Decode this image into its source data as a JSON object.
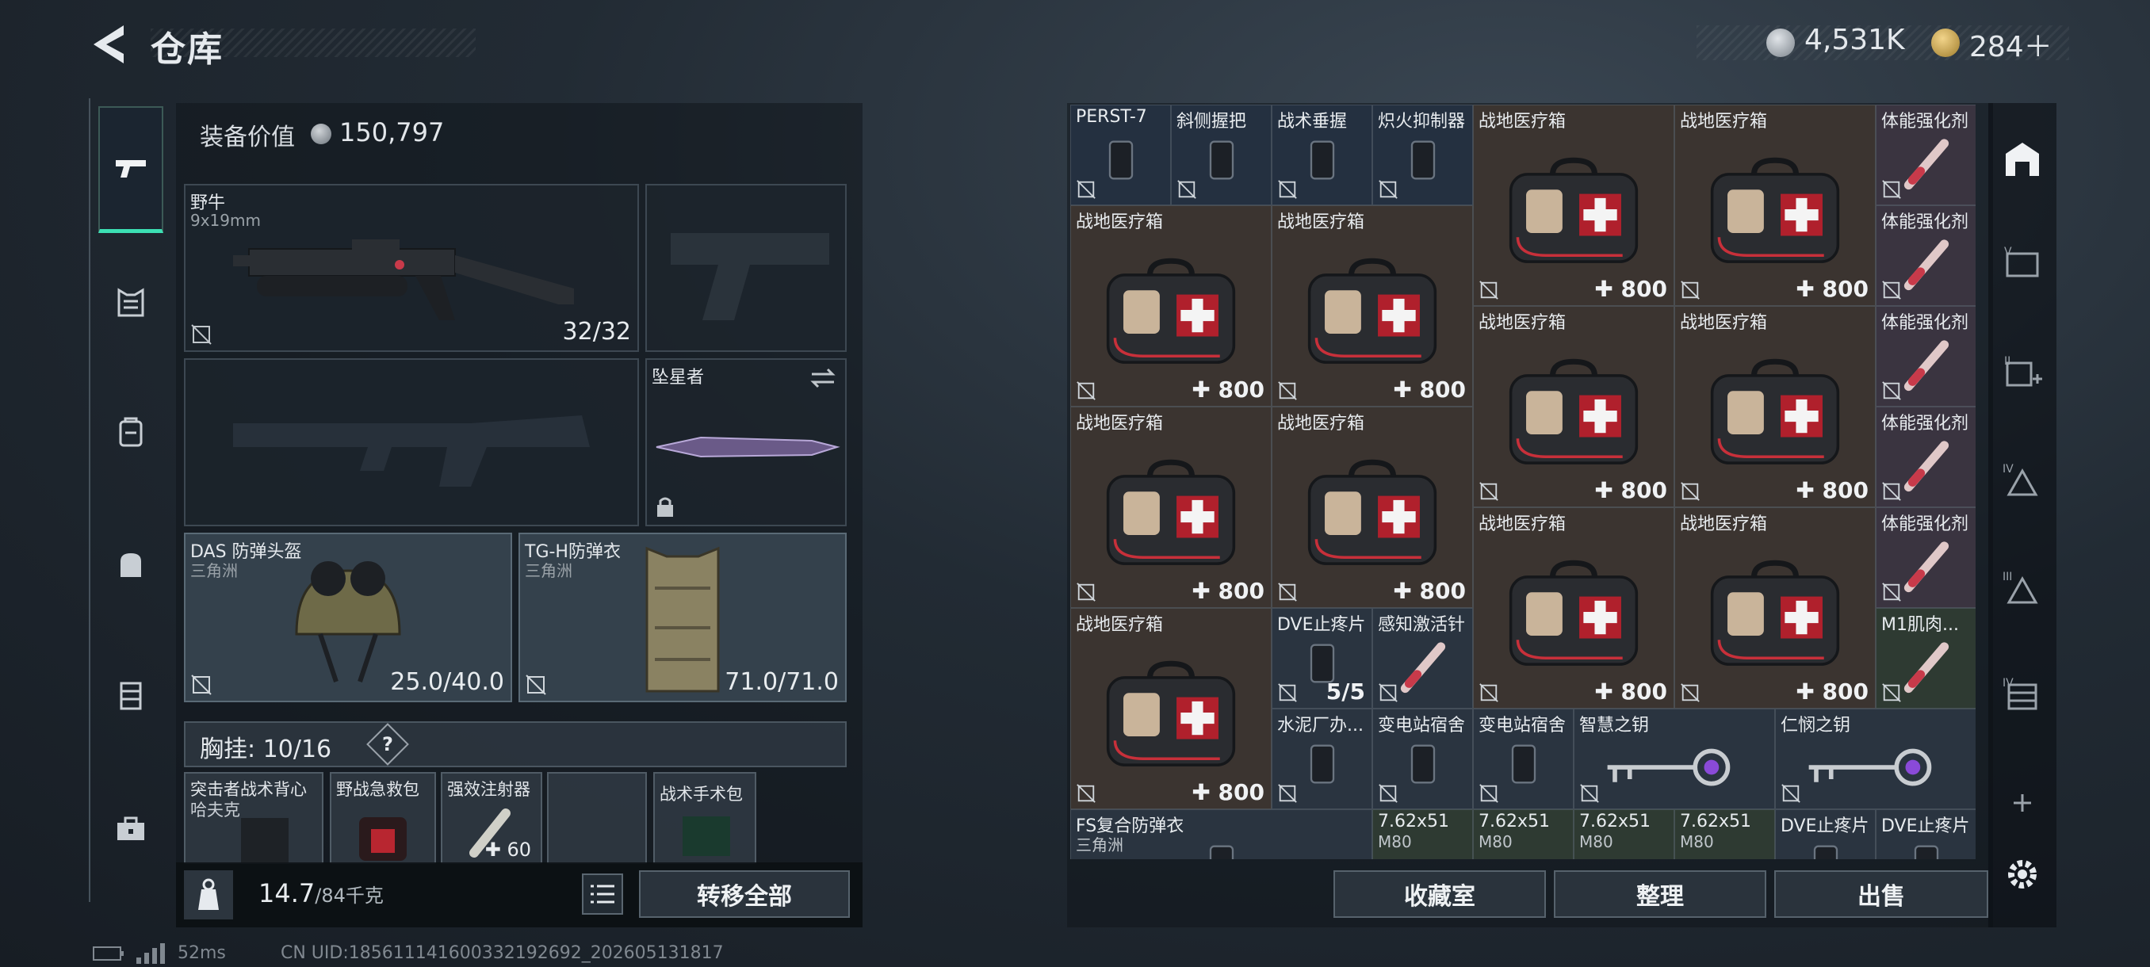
{
  "header": {
    "title": "仓库",
    "silver_amount": "4,531K",
    "gold_amount": "284＋"
  },
  "nav": {
    "items": [
      "weapons",
      "armor",
      "backpack-alt",
      "backpack",
      "chest-rig",
      "toolbox"
    ],
    "active": "weapons"
  },
  "equipment": {
    "value_label": "装备价值",
    "value": "150,797",
    "primary_weapon": {
      "name": "野牛",
      "ammo_type": "9x19mm",
      "ammo": "32/32"
    },
    "melee": {
      "name": "坠星者"
    },
    "helmet": {
      "name": "DAS 防弹头盔",
      "origin": "三角洲",
      "durability": "25.0/40.0"
    },
    "body_armor": {
      "name": "TG-H防弹衣",
      "origin": "三角洲",
      "durability": "71.0/71.0"
    },
    "chest_rig_label": "胸挂:",
    "chest_rig_capacity": "10/16",
    "help": "?",
    "rig_items": [
      {
        "name": "突击者战术背心",
        "sub": "哈夫克"
      },
      {
        "name": "野战急救包"
      },
      {
        "name": "强效注射器",
        "value": "60"
      },
      {
        "name": ""
      },
      {
        "name": "战术手术包"
      }
    ],
    "weight_value": "14.7",
    "weight_max": "/84千克",
    "transfer_all": "转移全部"
  },
  "storage": {
    "cells": [
      {
        "name": "PERST-7",
        "color": "blue"
      },
      {
        "name": "斜侧握把",
        "color": "blue"
      },
      {
        "name": "战术垂握",
        "color": "blue"
      },
      {
        "name": "炽火抑制器",
        "color": "blue"
      },
      {
        "name": "战地医疗箱",
        "value": "800",
        "color": "tan"
      },
      {
        "name": "战地医疗箱",
        "value": "800",
        "color": "tan"
      },
      {
        "name": "体能强化剂",
        "color": "pink"
      },
      {
        "name": "战地医疗箱",
        "value": "800",
        "color": "tan"
      },
      {
        "name": "战地医疗箱",
        "value": "800",
        "color": "tan"
      },
      {
        "name": "体能强化剂",
        "color": "pink"
      },
      {
        "name": "战地医疗箱",
        "value": "800",
        "color": "tan"
      },
      {
        "name": "战地医疗箱",
        "value": "800",
        "color": "tan"
      },
      {
        "name": "体能强化剂",
        "color": "pink"
      },
      {
        "name": "战地医疗箱",
        "value": "800",
        "color": "tan"
      },
      {
        "name": "战地医疗箱",
        "value": "800",
        "color": "tan"
      },
      {
        "name": "体能强化剂",
        "color": "pink"
      },
      {
        "name": "战地医疗箱",
        "value": "800",
        "color": "tan"
      },
      {
        "name": "战地医疗箱",
        "value": "800",
        "color": "tan"
      },
      {
        "name": "战地医疗箱",
        "value": "800",
        "color": "tan"
      },
      {
        "name": "体能强化剂",
        "color": "pink"
      },
      {
        "name": "战地医疗箱",
        "value": "800",
        "color": "tan"
      },
      {
        "name": "DVE止疼片",
        "value": "5/5",
        "color": "slate"
      },
      {
        "name": "感知激活针",
        "color": "slate"
      },
      {
        "name": "M1肌肉...",
        "color": "olive"
      },
      {
        "name": "水泥厂办...",
        "color": "slate"
      },
      {
        "name": "变电站宿舍",
        "color": "slate"
      },
      {
        "name": "变电站宿舍",
        "color": "slate"
      },
      {
        "name": "智慧之钥",
        "color": "slate"
      },
      {
        "name": "仁悯之钥",
        "color": "slate"
      },
      {
        "name": "FS复合防弹衣",
        "sub": "三角洲",
        "color": "slate"
      },
      {
        "name": "7.62x51",
        "sub": "M80",
        "color": "olive"
      },
      {
        "name": "7.62x51",
        "sub": "M80",
        "color": "olive"
      },
      {
        "name": "7.62x51",
        "sub": "M80",
        "color": "olive"
      },
      {
        "name": "7.62x51",
        "sub": "M80",
        "color": "olive"
      },
      {
        "name": "DVE止疼片",
        "color": "slate"
      },
      {
        "name": "DVE止疼片",
        "color": "slate"
      }
    ],
    "actions": {
      "collection": "收藏室",
      "organize": "整理",
      "sell": "出售"
    }
  },
  "footer": {
    "ping": "52ms",
    "uid": "CN UID:18561114160033219269​2_202605131817"
  },
  "colors": {
    "accent": "#3ce0b4",
    "blue_cell": "#243040",
    "tan_cell": "#3b3430",
    "pink_cell": "#3a3440"
  }
}
